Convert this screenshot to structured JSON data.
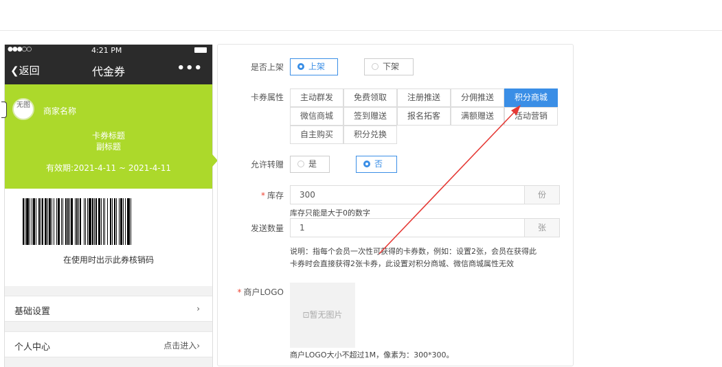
{
  "phone": {
    "status_time": "4:21 PM",
    "nav_back": "返回",
    "nav_title": "代金券",
    "nav_more": "•••",
    "card": {
      "logo_text": "无图",
      "merchant_name": "商家名称",
      "title": "卡券标题",
      "subtitle": "副标题",
      "validity": "有效期:2021-4-11 ~ 2021-4-11",
      "color": "#acd92b"
    },
    "barcode_tip": "在使用时出示此券核销码",
    "menu": [
      {
        "label": "基础设置",
        "right": "›"
      },
      {
        "label": "个人中心",
        "right": "点击进入›"
      }
    ]
  },
  "form": {
    "listing": {
      "label": "是否上架",
      "options": [
        {
          "label": "上架",
          "selected": true
        },
        {
          "label": "下架",
          "selected": false
        }
      ]
    },
    "attributes": {
      "label": "卡券属性",
      "tags": [
        {
          "label": "主动群发",
          "selected": false
        },
        {
          "label": "免费领取",
          "selected": false
        },
        {
          "label": "注册推送",
          "selected": false
        },
        {
          "label": "分佣推送",
          "selected": false
        },
        {
          "label": "积分商城",
          "selected": true
        },
        {
          "label": "微信商城",
          "selected": false
        },
        {
          "label": "签到赠送",
          "selected": false
        },
        {
          "label": "报名拓客",
          "selected": false
        },
        {
          "label": "满额赠送",
          "selected": false
        },
        {
          "label": "活动营销",
          "selected": false
        },
        {
          "label": "自主购买",
          "selected": false
        },
        {
          "label": "积分兑换",
          "selected": false
        }
      ]
    },
    "transfer": {
      "label": "允许转赠",
      "options": [
        {
          "label": "是",
          "selected": false
        },
        {
          "label": "否",
          "selected": true
        }
      ]
    },
    "stock": {
      "required_mark": "*",
      "label": "库存",
      "value": "300",
      "unit": "份",
      "help": "库存只能是大于0的数字"
    },
    "send_qty": {
      "label": "发送数量",
      "value": "1",
      "unit": "张",
      "help_line1": "说明：指每个会员一次性可获得的卡券数，例如：设置2张，会员在获得此",
      "help_line2": "卡券时会直接获得2张卡券，此设置对积分商城、微信商城属性无效"
    },
    "merchant_logo": {
      "required_mark": "*",
      "label": "商户LOGO",
      "placeholder": "暂无图片",
      "help": "商户LOGO大小不超过1M，像素为：300*300。"
    },
    "accent_color": "#3a8ee6",
    "annotation_color": "#e53935"
  }
}
